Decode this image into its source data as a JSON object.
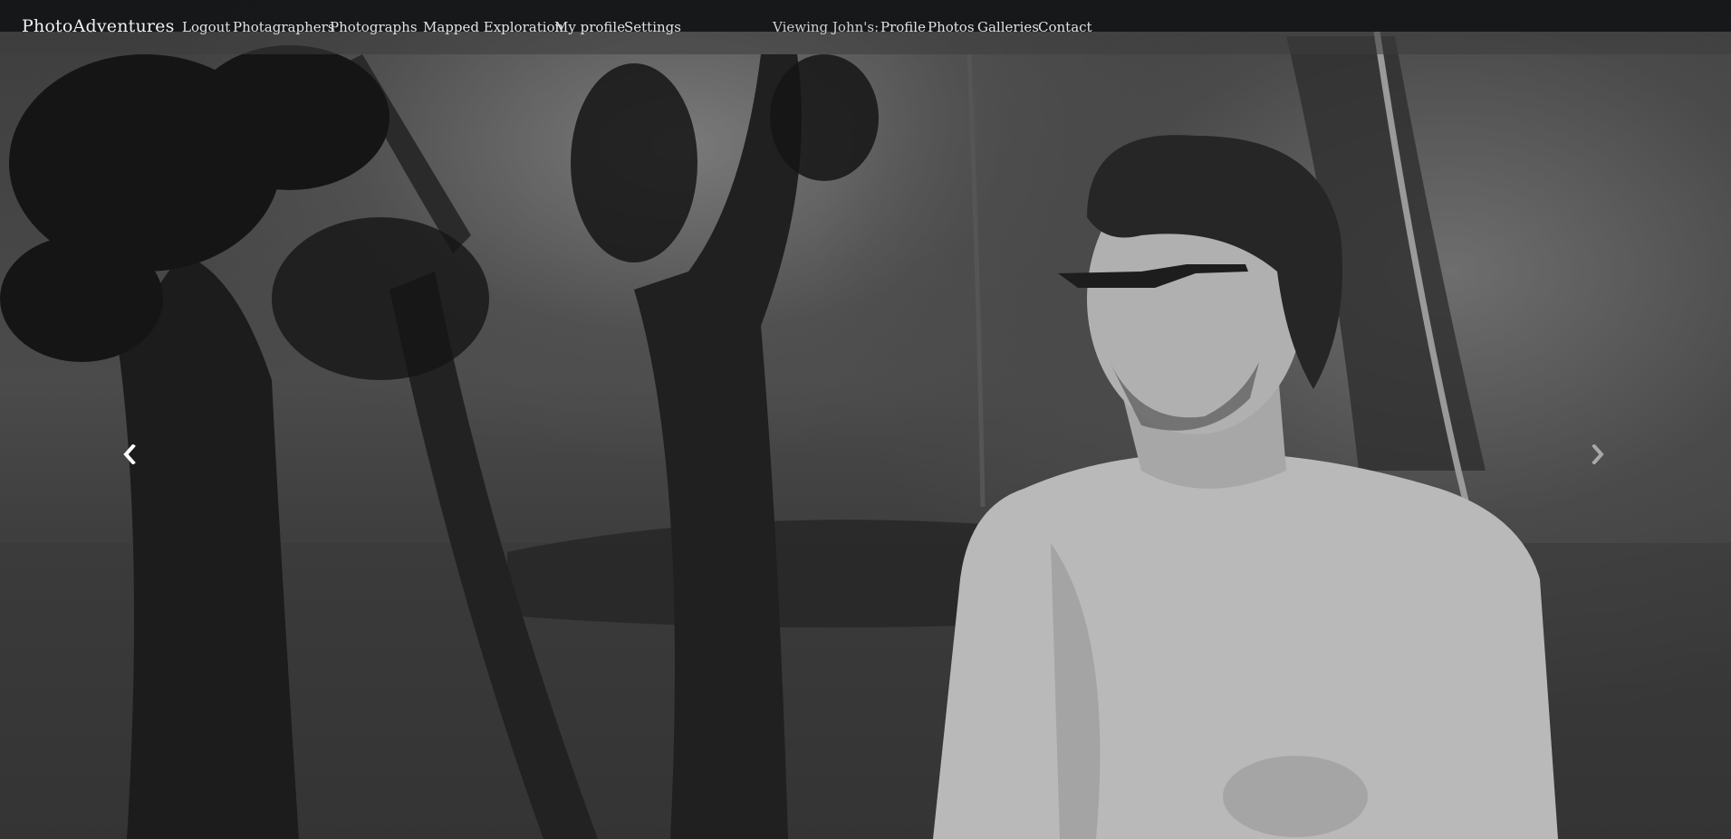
{
  "brand": "PhotoAdventures",
  "nav": {
    "logout": "Logout",
    "photagraphers": "Photagraphers",
    "photographs": "Photographs",
    "mapped_exploration": "Mapped Exploration",
    "my_profile": "My profile",
    "settings": "Settings"
  },
  "viewing": {
    "label": "Viewing John's:",
    "profile": "Profile",
    "photos": "Photos",
    "galleries": "Galleries",
    "contact": "Contact"
  },
  "carousel": {
    "prev_icon": "chevron-left-icon",
    "next_icon": "chevron-right-icon"
  },
  "colors": {
    "navbar_bg": "#141618",
    "nav_text": "#e2e2e2"
  }
}
